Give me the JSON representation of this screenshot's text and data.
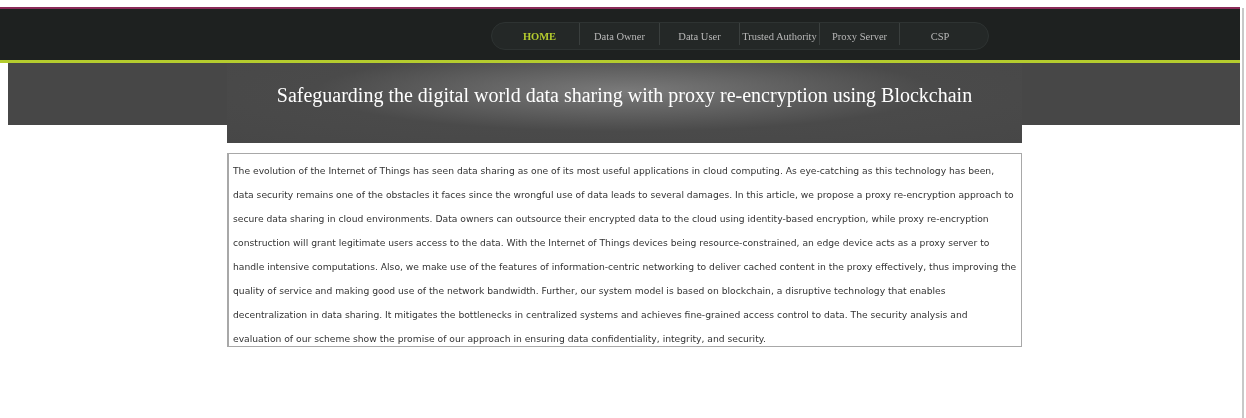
{
  "nav": [
    {
      "label": "HOME",
      "selected": true
    },
    {
      "label": "Data Owner",
      "selected": false
    },
    {
      "label": "Data User",
      "selected": false
    },
    {
      "label": "Trusted Authority",
      "selected": false
    },
    {
      "label": "Proxy Server",
      "selected": false
    },
    {
      "label": "CSP",
      "selected": false
    }
  ],
  "banner": {
    "title": "Safeguarding the digital world data sharing with proxy re-encryption using Blockchain"
  },
  "abstract": "The evolution of the Internet of Things has seen data sharing as one of its most useful applications in cloud computing. As eye-catching as this technology has been, data security remains one of the obstacles it faces since the wrongful use of data leads to several damages. In this article, we propose a proxy re-encryption approach to secure data sharing in cloud environments. Data owners can outsource their encrypted data to the cloud using identity-based encryption, while proxy re-encryption construction will grant legitimate users access to the data. With the Internet of Things devices being resource-constrained, an edge device acts as a proxy server to handle intensive computations. Also, we make use of the features of information-centric networking to deliver cached content in the proxy effectively, thus improving the quality of service and making good use of the network bandwidth. Further, our system model is based on blockchain, a disruptive technology that enables decentralization in data sharing. It mitigates the bottlenecks in centralized systems and achieves fine-grained access control to data. The security analysis and evaluation of our scheme show the promise of our approach in ensuring data confidentiality, integrity, and security."
}
